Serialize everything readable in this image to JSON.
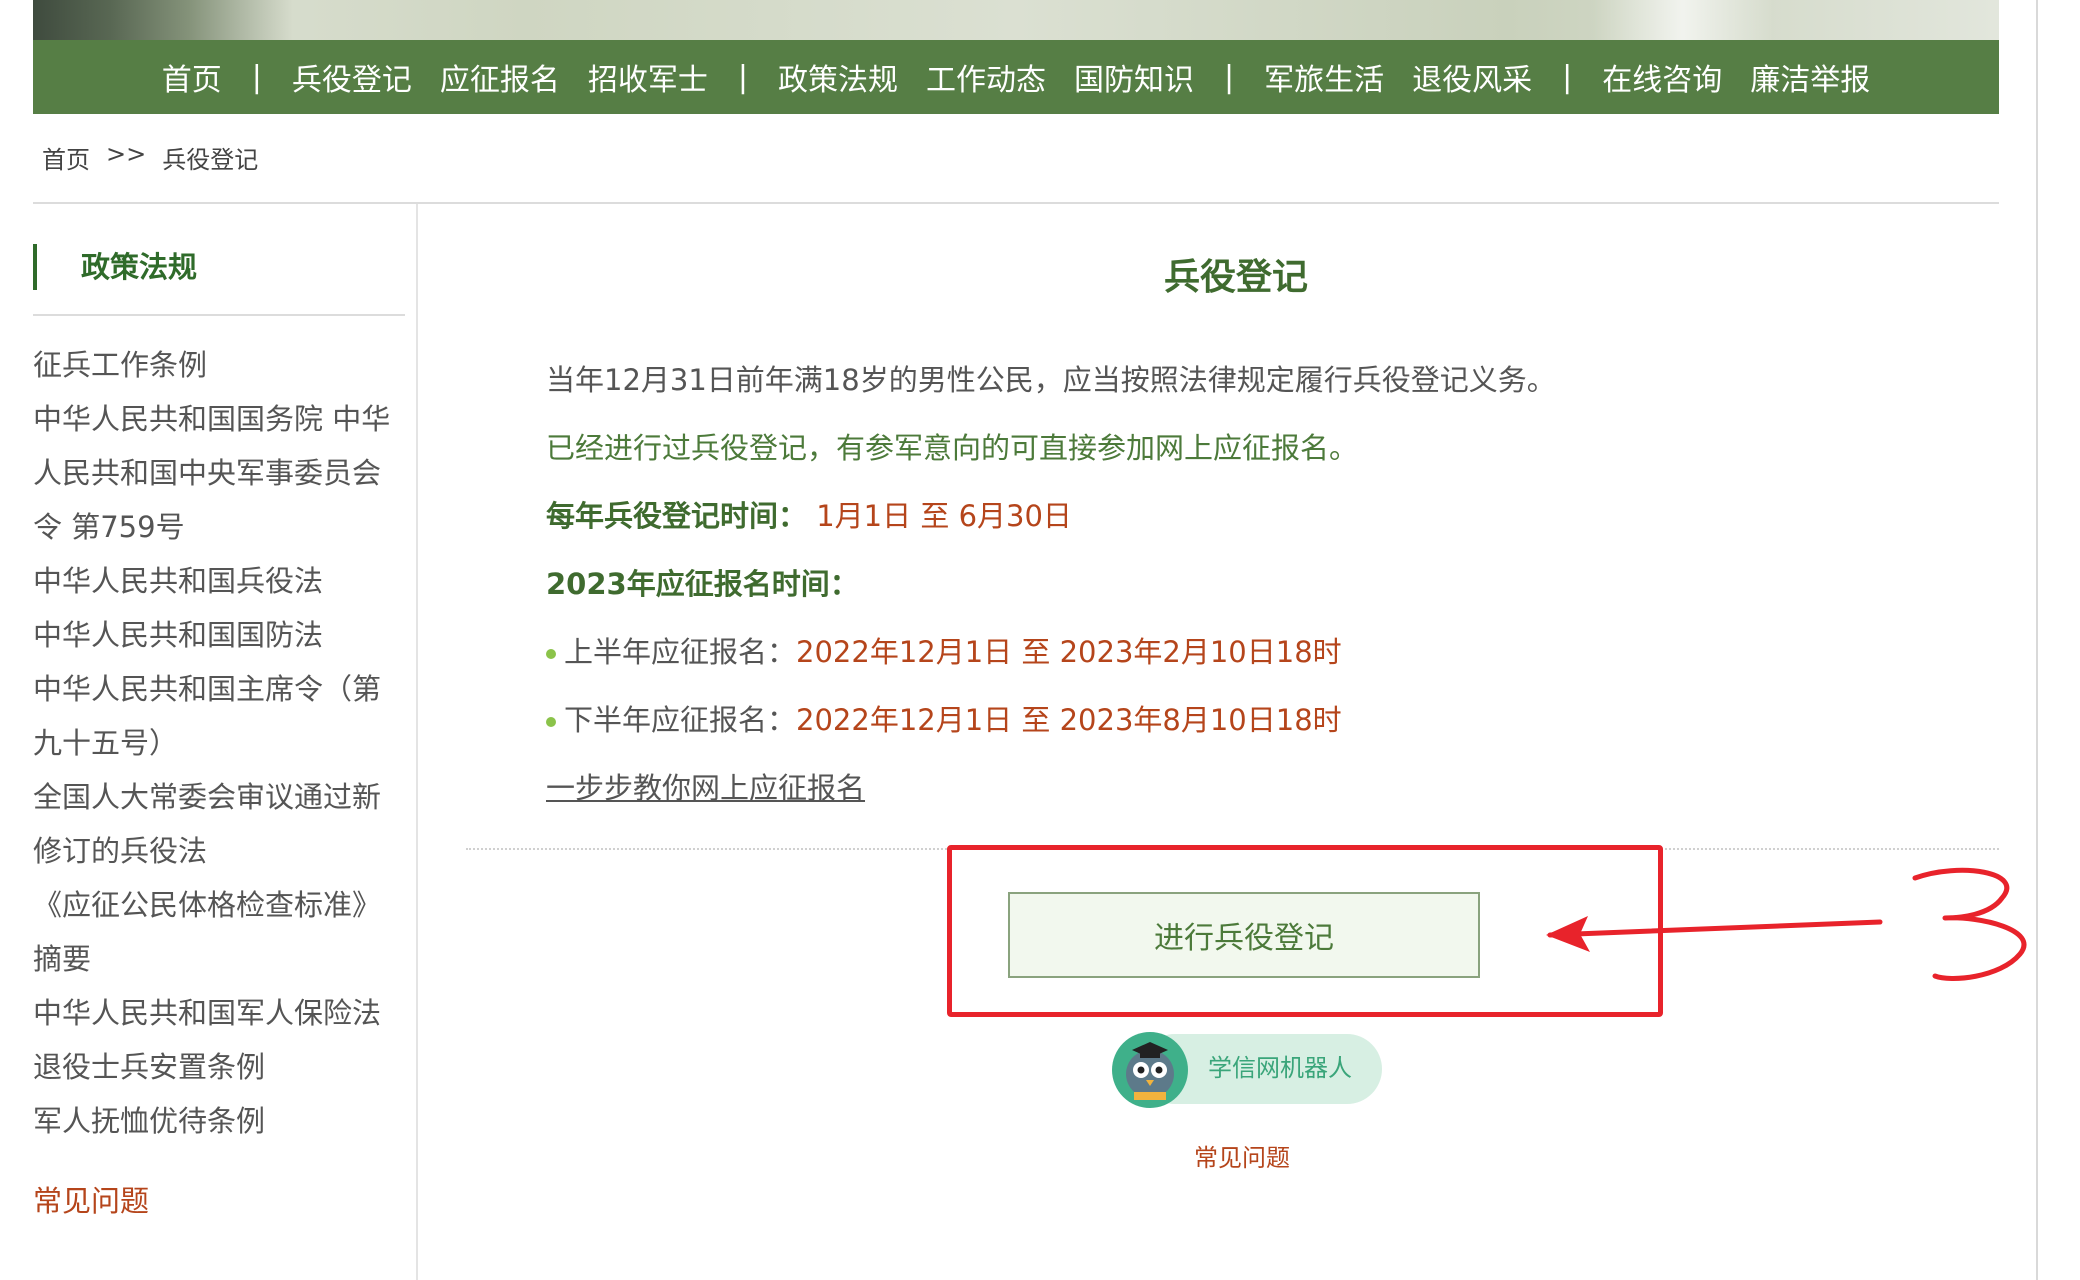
{
  "nav": {
    "items": [
      {
        "label": "首页",
        "sep_after": true
      },
      {
        "label": "兵役登记",
        "sep_after": false
      },
      {
        "label": "应征报名",
        "sep_after": false
      },
      {
        "label": "招收军士",
        "sep_after": true
      },
      {
        "label": "政策法规",
        "sep_after": false
      },
      {
        "label": "工作动态",
        "sep_after": false
      },
      {
        "label": "国防知识",
        "sep_after": true
      },
      {
        "label": "军旅生活",
        "sep_after": false
      },
      {
        "label": "退役风采",
        "sep_after": true
      },
      {
        "label": "在线咨询",
        "sep_after": false
      },
      {
        "label": "廉洁举报",
        "sep_after": false
      }
    ],
    "separator": "|"
  },
  "breadcrumb": {
    "home": "首页",
    "separator": ">>",
    "current": "兵役登记"
  },
  "sidebar": {
    "title": "政策法规",
    "items": [
      "征兵工作条例",
      "中华人民共和国国务院 中华",
      "人民共和国中央军事委员会",
      "令 第759号",
      "中华人民共和国兵役法",
      "中华人民共和国国防法",
      "中华人民共和国主席令（第",
      "九十五号）",
      "全国人大常委会审议通过新",
      "修订的兵役法",
      "《应征公民体格检查标准》",
      "摘要",
      "中华人民共和国军人保险法",
      "退役士兵安置条例",
      "军人抚恤优待条例"
    ],
    "faq": "常见问题"
  },
  "content": {
    "title": "兵役登记",
    "para1": "当年12月31日前年满18岁的男性公民，应当按照法律规定履行兵役登记义务。",
    "para2": "已经进行过兵役登记，有参军意向的可直接参加网上应征报名。",
    "period_label": "每年兵役登记时间：",
    "period_value": "1月1日 至 6月30日",
    "enlist_label": "2023年应征报名时间：",
    "first_half_label": "上半年应征报名：",
    "first_half_value": "2022年12月1日 至 2023年2月10日18时",
    "second_half_label": "下半年应征报名：",
    "second_half_value": "2022年12月1日 至 2023年8月10日18时",
    "guide_link": "一步步教你网上应征报名",
    "register_button": "进行兵役登记",
    "robot_label": "学信网机器人",
    "faq_link": "常见问题"
  },
  "colors": {
    "nav_bg": "#567e45",
    "title_green": "#3f6b2f",
    "accent_red": "#b5451b",
    "annotation_red": "#e8232b",
    "button_bg": "#f2f8ee",
    "robot_pill": "#d7efe3"
  }
}
